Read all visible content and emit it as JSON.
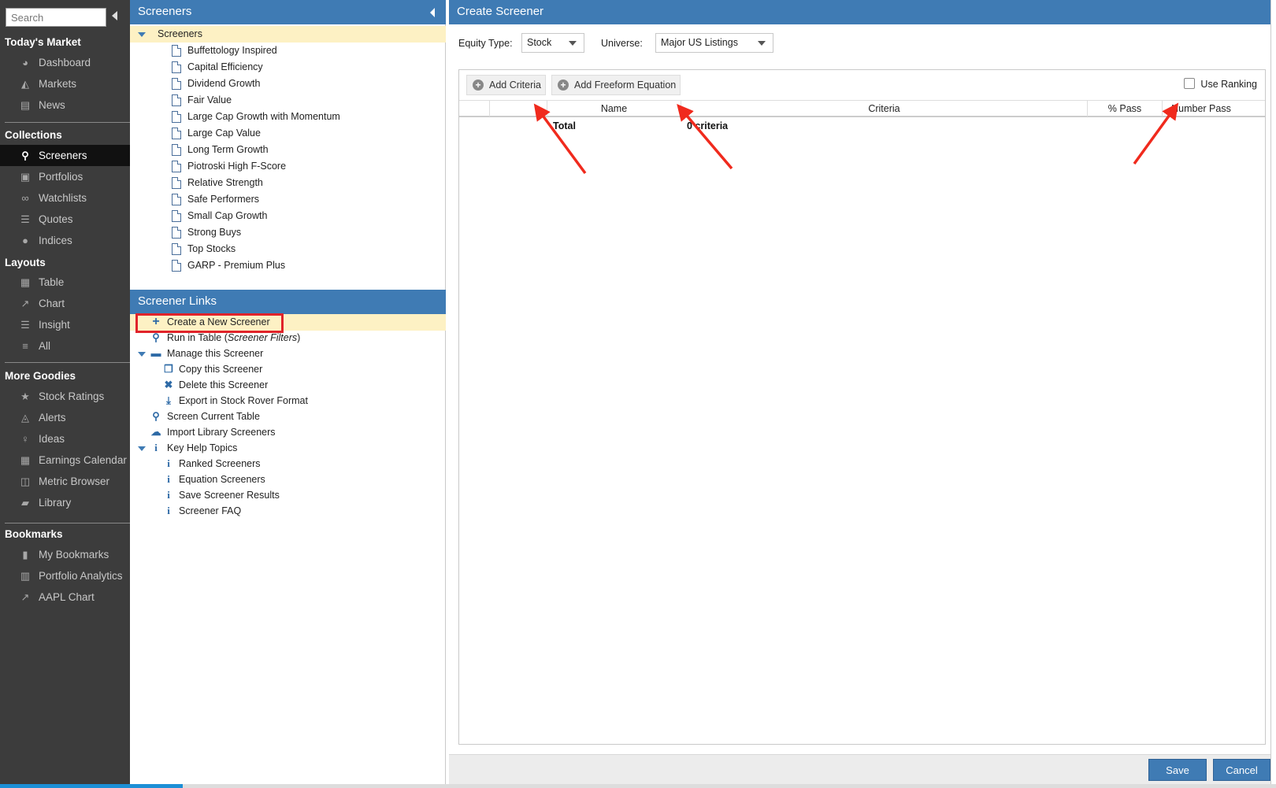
{
  "nav": {
    "search_placeholder": "Search",
    "sections": {
      "todays_market": "Today's Market",
      "collections": "Collections",
      "layouts": "Layouts",
      "more_goodies": "More Goodies",
      "bookmarks": "Bookmarks"
    },
    "items": {
      "dashboard": "Dashboard",
      "markets": "Markets",
      "news": "News",
      "screeners": "Screeners",
      "portfolios": "Portfolios",
      "watchlists": "Watchlists",
      "quotes": "Quotes",
      "indices": "Indices",
      "table": "Table",
      "chart": "Chart",
      "insight": "Insight",
      "all": "All",
      "stock_ratings": "Stock Ratings",
      "alerts": "Alerts",
      "ideas": "Ideas",
      "earnings_calendar": "Earnings Calendar",
      "metric_browser": "Metric Browser",
      "library": "Library",
      "my_bookmarks": "My Bookmarks",
      "portfolio_analytics": "Portfolio Analytics",
      "aapl_chart": "AAPL Chart"
    }
  },
  "screeners_panel": {
    "title": "Screeners",
    "root": "Screeners",
    "items": [
      "Buffettology Inspired",
      "Capital Efficiency",
      "Dividend Growth",
      "Fair Value",
      "Large Cap Growth with Momentum",
      "Large Cap Value",
      "Long Term Growth",
      "Piotroski High F-Score",
      "Relative Strength",
      "Safe Performers",
      "Small Cap Growth",
      "Strong Buys",
      "Top Stocks",
      "GARP - Premium Plus"
    ]
  },
  "links_panel": {
    "title": "Screener Links",
    "create": "Create a New Screener",
    "run_in_table": "Run in Table (",
    "run_in_table_em": "Screener Filters",
    "run_in_table_close": ")",
    "manage": "Manage this Screener",
    "copy": "Copy this Screener",
    "delete": "Delete this Screener",
    "export": "Export in Stock Rover Format",
    "screen_current": "Screen Current Table",
    "import_library": "Import Library Screeners",
    "help_topics": "Key Help Topics",
    "ranked": "Ranked Screeners",
    "equation": "Equation Screeners",
    "save_results": "Save Screener Results",
    "faq": "Screener FAQ"
  },
  "create_panel": {
    "title": "Create Screener",
    "equity_type_label": "Equity Type:",
    "equity_type_value": "Stock",
    "universe_label": "Universe:",
    "universe_value": "Major US Listings",
    "add_criteria": "Add Criteria",
    "add_freeform": "Add Freeform Equation",
    "use_ranking": "Use Ranking",
    "columns": [
      "Name",
      "Criteria",
      "% Pass",
      "Number Pass"
    ],
    "total_label": "Total",
    "criteria_count": "0 criteria",
    "save": "Save",
    "cancel": "Cancel"
  },
  "colors": {
    "header_blue": "#3f7bb4",
    "nav_bg": "#3c3c3c",
    "selection_yellow": "#fdf1c4",
    "highlight_red": "#e0232a",
    "arrow_red": "#f02a1d"
  }
}
